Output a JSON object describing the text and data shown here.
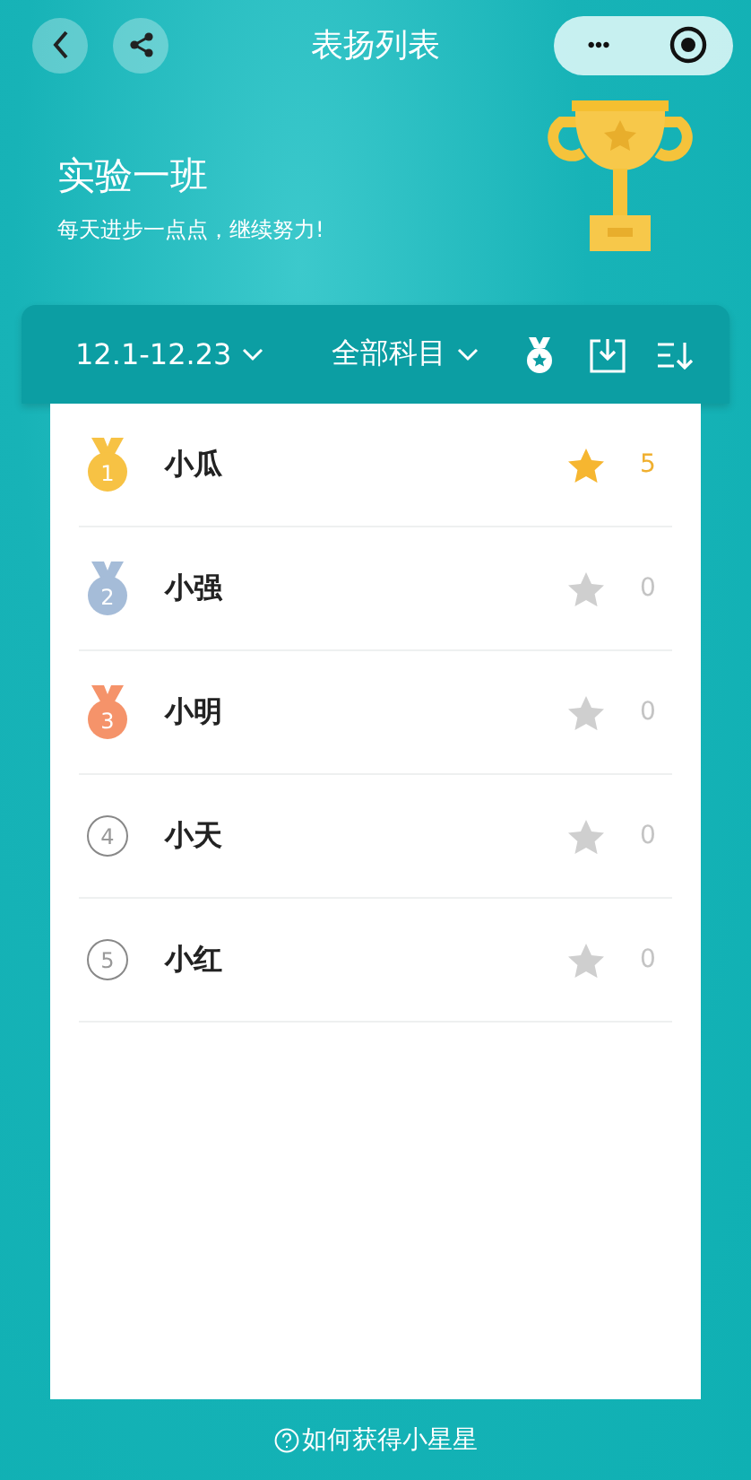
{
  "nav": {
    "title": "表扬列表",
    "more": "•••"
  },
  "hero": {
    "class_name": "实验一班",
    "motto": "每天进步一点点，继续努力!"
  },
  "filters": {
    "date_range": "12.1-12.23",
    "subject": "全部科目"
  },
  "students": [
    {
      "rank": "1",
      "name": "小瓜",
      "kind": "medal",
      "color": "#f7c244",
      "stars": "5",
      "highlighted": true
    },
    {
      "rank": "2",
      "name": "小强",
      "kind": "medal",
      "color": "#a5bcd8",
      "stars": "0",
      "highlighted": false
    },
    {
      "rank": "3",
      "name": "小明",
      "kind": "medal",
      "color": "#f5936a",
      "stars": "0",
      "highlighted": false
    },
    {
      "rank": "4",
      "name": "小天",
      "kind": "circle",
      "stars": "0",
      "highlighted": false
    },
    {
      "rank": "5",
      "name": "小红",
      "kind": "circle",
      "stars": "0",
      "highlighted": false
    }
  ],
  "help_link": "如何获得小星星"
}
